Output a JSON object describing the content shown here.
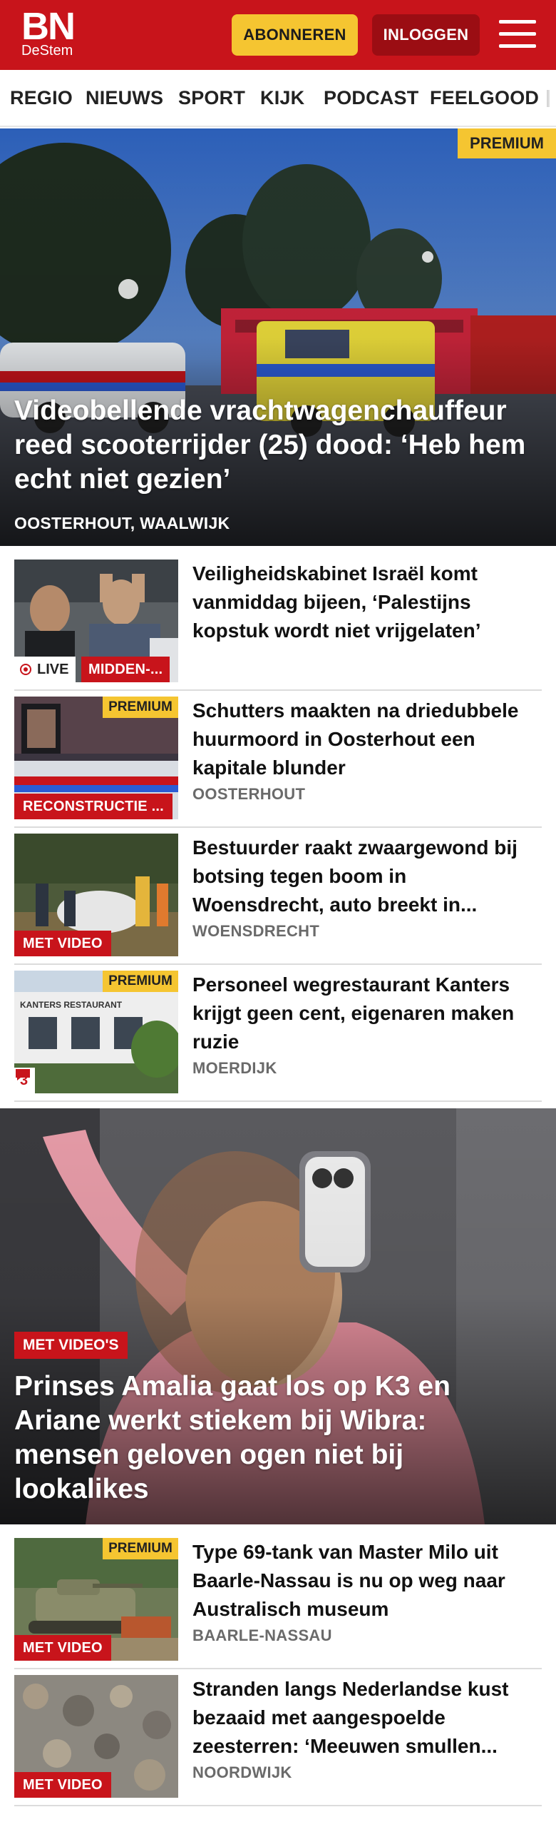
{
  "header": {
    "logo_main": "BN",
    "logo_sub": "DeStem",
    "subscribe_label": "ABONNEREN",
    "login_label": "INLOGGEN",
    "brand_color": "#c8141b",
    "subscribe_color": "#f5c531"
  },
  "nav": {
    "items": [
      "REGIO",
      "NIEUWS",
      "SPORT",
      "KIJK",
      "PODCAST",
      "FEELGOOD"
    ]
  },
  "hero": {
    "badge": "PREMIUM",
    "title": "Videobellende vrachtwagenchauffeur reed scooterrijder (25) dood: ‘Heb hem echt niet gezien’",
    "location": "OOSTERHOUT, WAALWIJK"
  },
  "articles": [
    {
      "title": "Veiligheidskabinet Israël komt vanmiddag bijeen, ‘Palestijns kopstuk wordt niet vrijgelaten’",
      "live_label": "LIVE",
      "label": "MIDDEN-..."
    },
    {
      "title": "Schutters maakten na driedubbele huurmoord in Oosterhout een kapitale blunder",
      "location": "OOSTERHOUT",
      "badge": "PREMIUM",
      "label": "RECONSTRUCTIE ..."
    },
    {
      "title": "Bestuurder raakt zwaargewond bij botsing tegen boom in Woensdrecht, auto breekt in...",
      "location": "WOENSDRECHT",
      "label": "MET VIDEO"
    },
    {
      "title": "Personeel wegrestaurant Kanters krijgt geen cent, eigenaren maken ruzie",
      "location": "MOERDIJK",
      "badge": "PREMIUM",
      "comment_count": "3",
      "sign_text": "KANTERS RESTAURANT"
    }
  ],
  "feature": {
    "label": "MET VIDEO'S",
    "title": "Prinses Amalia gaat los op K3 en Ariane werkt stiekem bij Wibra: mensen geloven ogen niet bij lookalikes"
  },
  "articles_bottom": [
    {
      "title": "Type 69-tank van Master Milo uit Baarle-Nassau is nu op weg naar Australisch museum",
      "location": "BAARLE-NASSAU",
      "badge": "PREMIUM",
      "label": "MET VIDEO"
    },
    {
      "title": "Stranden langs Nederlandse kust bezaaid met aangespoelde zeesterren: ‘Meeuwen smullen...",
      "location": "NOORDWIJK",
      "label": "MET VIDEO"
    }
  ],
  "icons": {
    "menu": "hamburger-menu-icon",
    "live": "live-dot-icon",
    "comment": "comment-bubble-icon"
  }
}
